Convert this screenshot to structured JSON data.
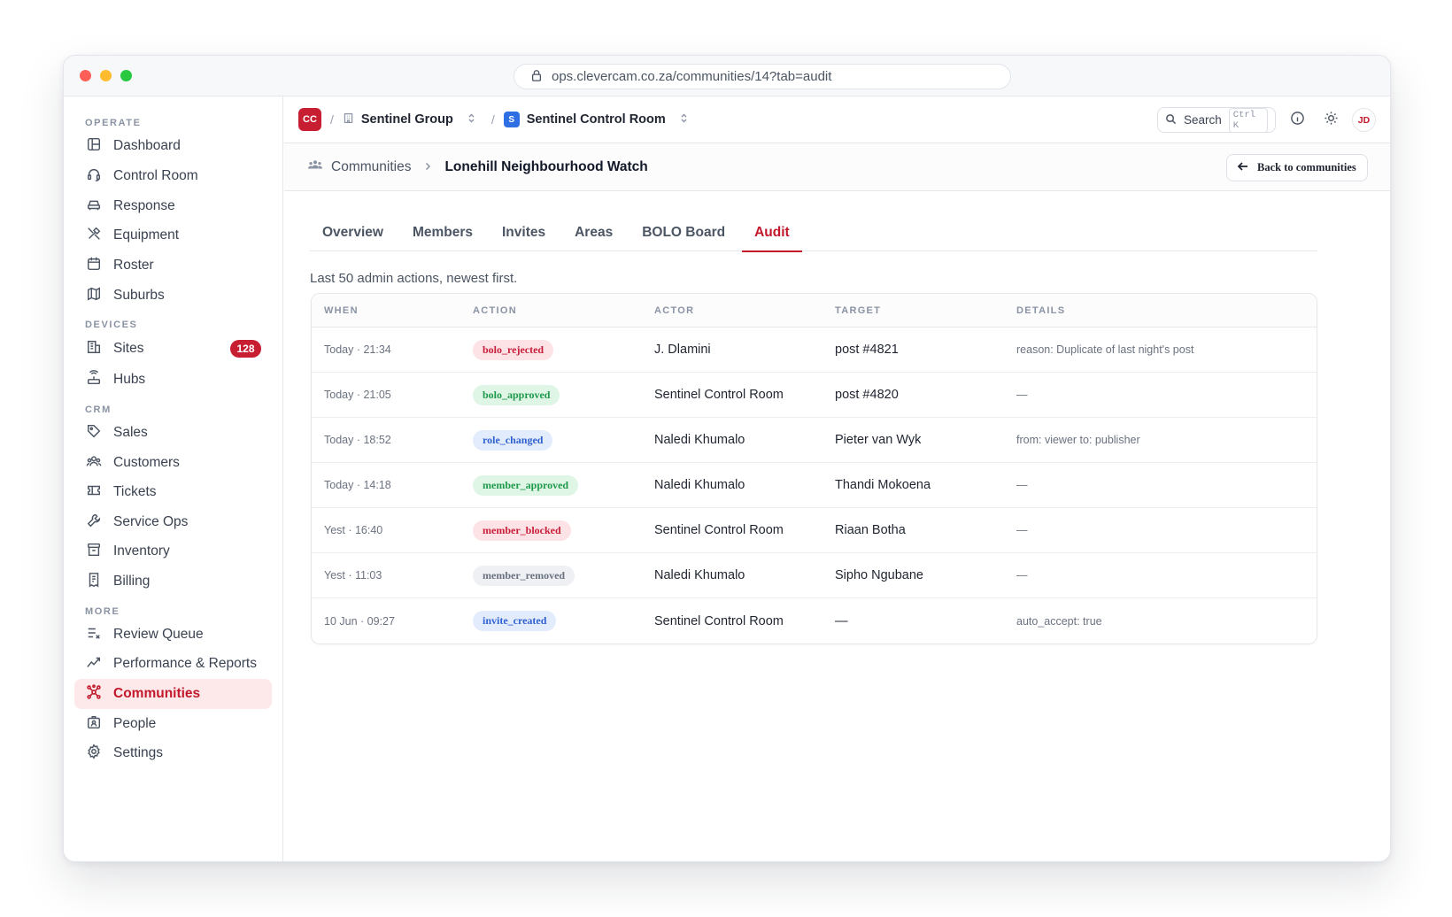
{
  "browser": {
    "url": "ops.clevercam.co.za/communities/14?tab=audit"
  },
  "sidebar": {
    "sections": [
      {
        "label": "OPERATE"
      },
      {
        "label": "DEVICES"
      },
      {
        "label": "CRM"
      },
      {
        "label": "MORE"
      }
    ],
    "items": [
      {
        "label": "Dashboard",
        "icon": "dashboard-icon"
      },
      {
        "label": "Control Room",
        "icon": "headset-icon"
      },
      {
        "label": "Response",
        "icon": "car-icon"
      },
      {
        "label": "Equipment",
        "icon": "tools-icon"
      },
      {
        "label": "Roster",
        "icon": "calendar-icon"
      },
      {
        "label": "Suburbs",
        "icon": "map-icon"
      },
      {
        "label": "Sites",
        "icon": "building-icon",
        "badge": "128"
      },
      {
        "label": "Hubs",
        "icon": "router-icon"
      },
      {
        "label": "Sales",
        "icon": "tag-icon"
      },
      {
        "label": "Customers",
        "icon": "users-icon"
      },
      {
        "label": "Tickets",
        "icon": "ticket-icon"
      },
      {
        "label": "Service Ops",
        "icon": "wrench-icon"
      },
      {
        "label": "Inventory",
        "icon": "archive-icon"
      },
      {
        "label": "Billing",
        "icon": "receipt-icon"
      },
      {
        "label": "Review Queue",
        "icon": "list-check-icon"
      },
      {
        "label": "Performance & Reports",
        "icon": "trend-icon"
      },
      {
        "label": "Communities",
        "icon": "network-icon",
        "active": true
      },
      {
        "label": "People",
        "icon": "id-card-icon"
      },
      {
        "label": "Settings",
        "icon": "gear-icon"
      }
    ]
  },
  "topbar": {
    "org_logo": "CC",
    "org_name": "Sentinel Group",
    "workspace_logo": "S",
    "workspace_name": "Sentinel Control Room",
    "search_label": "Search",
    "search_shortcut": "Ctrl K",
    "avatar": "JD"
  },
  "pagebar": {
    "parent": "Communities",
    "current": "Lonehill Neighbourhood Watch",
    "back_label": "Back to communities"
  },
  "tabs": [
    {
      "label": "Overview"
    },
    {
      "label": "Members"
    },
    {
      "label": "Invites"
    },
    {
      "label": "Areas"
    },
    {
      "label": "BOLO Board"
    },
    {
      "label": "Audit",
      "active": true
    }
  ],
  "subtitle": "Last 50 admin actions, newest first.",
  "table": {
    "headers": [
      "WHEN",
      "ACTION",
      "ACTOR",
      "TARGET",
      "DETAILS"
    ],
    "rows": [
      {
        "when": "Today · 21:34",
        "action": "bolo_rejected",
        "tone": "red",
        "actor": "J. Dlamini",
        "target": "post #4821",
        "details": "reason: Duplicate of last night's post"
      },
      {
        "when": "Today · 21:05",
        "action": "bolo_approved",
        "tone": "green",
        "actor": "Sentinel Control Room",
        "target": "post #4820",
        "details": "—"
      },
      {
        "when": "Today · 18:52",
        "action": "role_changed",
        "tone": "blue",
        "actor": "Naledi Khumalo",
        "target": "Pieter van Wyk",
        "details": "from: viewer to: publisher"
      },
      {
        "when": "Today · 14:18",
        "action": "member_approved",
        "tone": "green",
        "actor": "Naledi Khumalo",
        "target": "Thandi Mokoena",
        "details": "—"
      },
      {
        "when": "Yest · 16:40",
        "action": "member_blocked",
        "tone": "red",
        "actor": "Sentinel Control Room",
        "target": "Riaan Botha",
        "details": "—"
      },
      {
        "when": "Yest · 11:03",
        "action": "member_removed",
        "tone": "gray",
        "actor": "Naledi Khumalo",
        "target": "Sipho Ngubane",
        "details": "—"
      },
      {
        "when": "10 Jun · 09:27",
        "action": "invite_created",
        "tone": "blue",
        "actor": "Sentinel Control Room",
        "target": "—",
        "details": "auto_accept: true"
      }
    ]
  },
  "colors": {
    "accent": "#c2182b",
    "active_bg": "#fde8ea"
  }
}
